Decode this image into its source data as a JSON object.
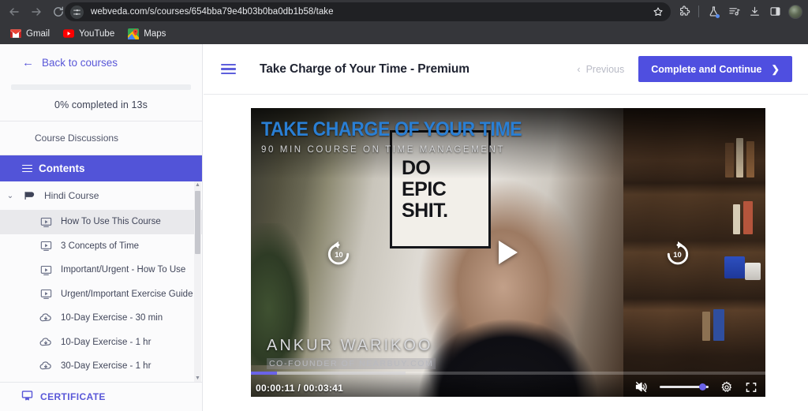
{
  "browser": {
    "back_label": "Back",
    "forward_label": "Forward",
    "reload_label": "Reload",
    "url": "webveda.com/s/courses/654bba79e4b03b0ba0db1b58/take",
    "site_settings_label": "View site information",
    "bookmark_star_label": "Bookmark this tab",
    "toolbar_icons": [
      {
        "name": "extensions-icon",
        "label": "Extensions"
      },
      {
        "name": "lab-icon",
        "label": "Experiments"
      },
      {
        "name": "playlist-icon",
        "label": "Reading list"
      },
      {
        "name": "download-icon",
        "label": "Downloads"
      },
      {
        "name": "side-panel-icon",
        "label": "Side panel"
      },
      {
        "name": "profile-avatar",
        "label": "Profile"
      }
    ],
    "bookmarks": [
      {
        "label": "Gmail",
        "icon": "gmail-icon"
      },
      {
        "label": "YouTube",
        "icon": "youtube-icon"
      },
      {
        "label": "Maps",
        "icon": "maps-icon"
      }
    ]
  },
  "sidebar": {
    "back_to_courses": "Back to courses",
    "progress_percent": 0,
    "progress_label_prefix": "0%",
    "progress_label_mid": " completed in ",
    "progress_label_suffix": "13s",
    "progress_label_full": "0% completed in 13s",
    "discussions_label": "Course Discussions",
    "contents_label": "Contents",
    "group_label": "Hindi Course",
    "certificate_label": "CERTIFICATE",
    "lessons": [
      {
        "label": "How To Use This Course",
        "icon": "video-icon",
        "active": true
      },
      {
        "label": "3 Concepts of Time",
        "icon": "video-icon",
        "active": false
      },
      {
        "label": "Important/Urgent - How To Use",
        "icon": "video-icon",
        "active": false
      },
      {
        "label": "Urgent/Important Exercise Guide",
        "icon": "video-icon",
        "active": false
      },
      {
        "label": "10-Day Exercise - 30 min",
        "icon": "cloud-download-icon",
        "active": false
      },
      {
        "label": "10-Day Exercise - 1 hr",
        "icon": "cloud-download-icon",
        "active": false
      },
      {
        "label": "30-Day Exercise - 1 hr",
        "icon": "cloud-download-icon",
        "active": false
      }
    ]
  },
  "main": {
    "menu_label": "Toggle course menu",
    "lesson_title": "Take Charge of Your Time - Premium",
    "previous_label": "Previous",
    "complete_label": "Complete and Continue"
  },
  "video": {
    "overlay_title": "TAKE CHARGE OF YOUR TIME",
    "overlay_subtitle": "90 MIN COURSE ON TIME MANAGEMENT",
    "poster_line1": "DO",
    "poster_line2": "EPIC",
    "poster_line3": "SHIT.",
    "speaker_name": "ANKUR WARIKOO",
    "speaker_role": "CO-FOUNDER OF NEARBUY.COM",
    "current_time": "00:00:11",
    "total_time": "00:03:41",
    "time_display": "00:00:11  / 00:03:41",
    "progress_percent": 5,
    "buffered_percent": 30,
    "rewind_seconds": "10",
    "forward_seconds": "10",
    "play_label": "Play",
    "muted": true,
    "volume_percent": 95,
    "settings_label": "Settings",
    "fullscreen_label": "Full screen"
  },
  "colors": {
    "accent_purple": "#5254d8",
    "button_purple": "#4f4fe0",
    "title_blue": "#2a7fd4",
    "chrome_dark": "#35363a",
    "omnibox_dark": "#202124"
  }
}
